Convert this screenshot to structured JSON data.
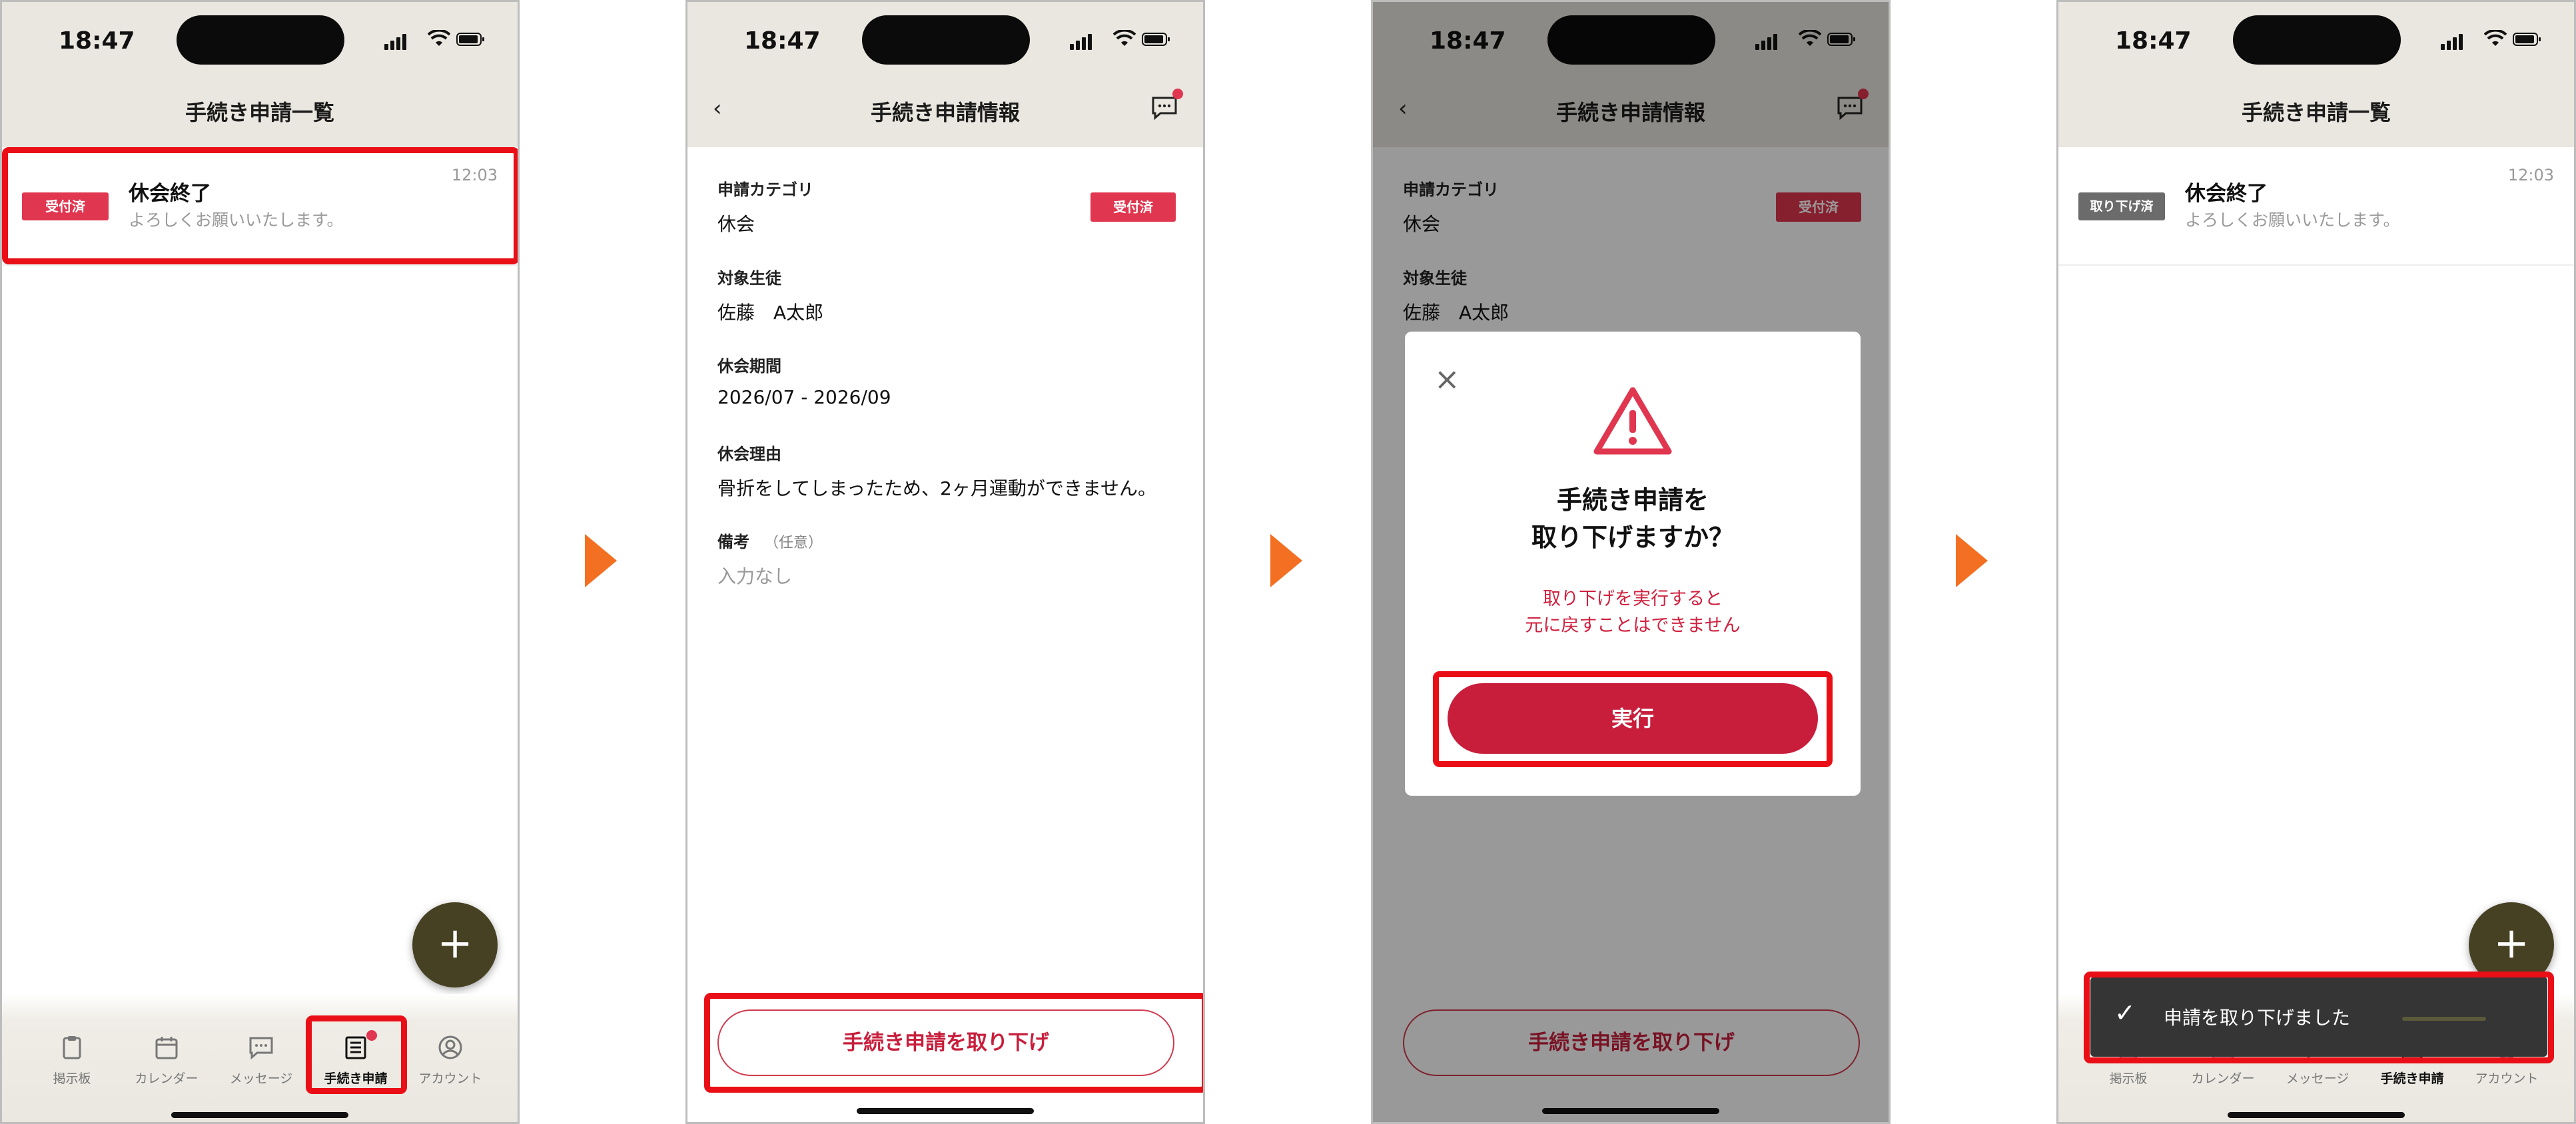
{
  "status": {
    "time": "18:47"
  },
  "screen1": {
    "title": "手続き申請一覧",
    "item": {
      "badge": "受付済",
      "title": "休会終了",
      "subtitle": "よろしくお願いいたします。",
      "time": "12:03"
    },
    "fab_symbol": "+"
  },
  "tabs": [
    {
      "label": "掲示板",
      "icon": "clipboard-icon"
    },
    {
      "label": "カレンダー",
      "icon": "calendar-icon"
    },
    {
      "label": "メッセージ",
      "icon": "message-icon"
    },
    {
      "label": "手続き申請",
      "icon": "application-list-icon"
    },
    {
      "label": "アカウント",
      "icon": "account-icon"
    }
  ],
  "screen2": {
    "title": "手続き申請情報",
    "back_symbol": "‹",
    "fields": [
      {
        "label": "申請カテゴリ",
        "value": "休会"
      },
      {
        "label": "対象生徒",
        "value": "佐藤　A太郎"
      },
      {
        "label": "休会期間",
        "value": "2026/07 - 2026/09"
      },
      {
        "label": "休会理由",
        "value": "骨折をしてしまったため、2ヶ月運動ができません。"
      },
      {
        "label": "備考",
        "optional": "（任意）",
        "value": "入力なし"
      }
    ],
    "badge": "受付済",
    "withdraw_button": "手続き申請を取り下げ"
  },
  "screen3": {
    "dialog": {
      "close_symbol": "×",
      "title_line1": "手続き申請を",
      "title_line2": "取り下げますか？",
      "warning_line1": "取り下げを実行すると",
      "warning_line2": "元に戻すことはできません",
      "execute_button": "実行"
    }
  },
  "screen4": {
    "title": "手続き申請一覧",
    "item": {
      "badge": "取り下げ済",
      "title": "休会終了",
      "subtitle": "よろしくお願いいたします。",
      "time": "12:03"
    },
    "toast": "申請を取り下げました",
    "toast_check": "✓"
  },
  "colors": {
    "accent_red": "#c81e3c",
    "badge_red": "#e0364f",
    "withdrawn_gray": "#6b6b6b",
    "header_bg": "#e9e7df",
    "fab": "#474124",
    "flow_arrow": "#f36f21"
  }
}
